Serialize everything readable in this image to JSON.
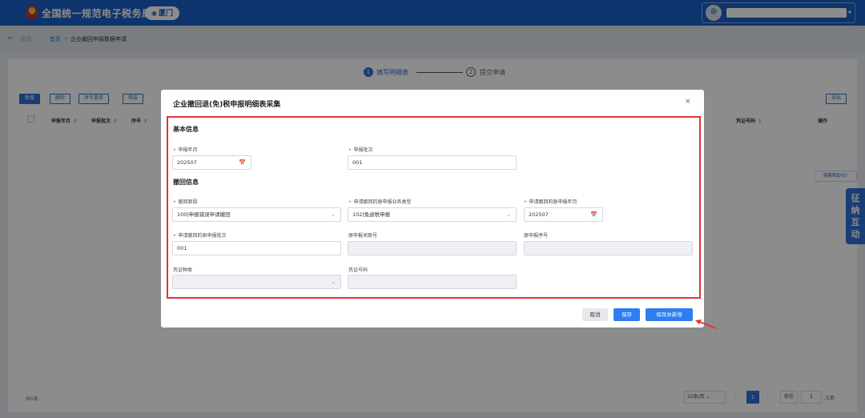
{
  "header": {
    "site_title": "全国统一规范电子税务局",
    "city": "厦门",
    "user_name": ""
  },
  "breadcrumb": {
    "back": "返回",
    "home": "首页",
    "separator": ">",
    "current": "企业撤回申报数据申请"
  },
  "steps": [
    {
      "number": "1",
      "label": "填写明细表",
      "active": true
    },
    {
      "number": "2",
      "label": "提交申请",
      "active": false
    }
  ],
  "toolbar": {
    "add": "新增",
    "delete": "删除",
    "reorder": "序号重排",
    "filter": "筛选",
    "export": "导出"
  },
  "table": {
    "columns": [
      "申报年月",
      "申报批次",
      "序号",
      "凭证号码",
      "操作"
    ]
  },
  "pagination": {
    "total_text": "共0条",
    "page_size": "10条/页",
    "current_page": "1",
    "goto_label": "前往",
    "page_input": "1",
    "total_pages": "/1页"
  },
  "help": {
    "bubble": "需要帮助吗?",
    "tab": [
      "征",
      "纳",
      "互",
      "动"
    ]
  },
  "modal": {
    "title": "企业撤回退(免)税申报明细表采集",
    "close": "×",
    "basic_section": "基本信息",
    "withdraw_section": "撤回信息",
    "fields": {
      "declare_month": {
        "label": "申报年月",
        "value": "202507",
        "required": true
      },
      "declare_batch": {
        "label": "申报批次",
        "value": "001",
        "required": true
      },
      "withdraw_reason": {
        "label": "撤回原因",
        "value": "100|申报错误申请撤回",
        "required": true
      },
      "orig_business_type": {
        "label": "申请撤回的原申报业务类型",
        "value": "102|免退税申报",
        "required": true
      },
      "orig_declare_month": {
        "label": "申请撤回的原申报年月",
        "value": "202507",
        "required": true
      },
      "orig_declare_batch": {
        "label": "申请撤回的原申报批次",
        "value": "001",
        "required": true
      },
      "orig_related_no": {
        "label": "原申报关联号",
        "value": ""
      },
      "orig_serial_no": {
        "label": "原申报序号",
        "value": ""
      },
      "voucher_type": {
        "label": "凭证种类",
        "value": ""
      },
      "voucher_no": {
        "label": "凭证号码",
        "value": ""
      }
    },
    "buttons": {
      "cancel": "取消",
      "save": "保存",
      "save_new": "保存并新增"
    }
  },
  "icons": {
    "calendar": "calendar-icon",
    "dropdown": "chevron-down-icon"
  },
  "colors": {
    "brand_blue": "#1b5fc6",
    "primary": "#2d7ef0",
    "highlight_red": "#e5333a"
  }
}
